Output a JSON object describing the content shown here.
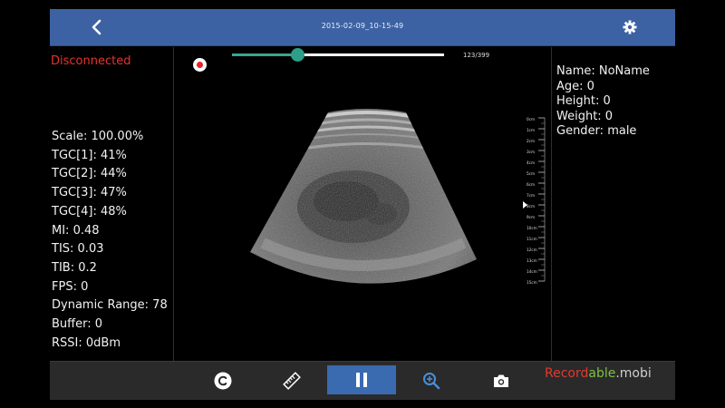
{
  "topbar": {
    "title": "2015-02-09_10-15-49",
    "back_icon": "chevron-left-icon",
    "settings_icon": "gear-icon"
  },
  "status": {
    "text": "Disconnected",
    "color": "#e8322f"
  },
  "params": [
    "Scale: 100.00%",
    "TGC[1]: 41%",
    "TGC[2]: 44%",
    "TGC[3]: 47%",
    "TGC[4]: 48%",
    "MI: 0.48",
    "TIS: 0.03",
    "TIB: 0.2",
    "FPS: 0",
    "Dynamic Range: 78",
    "Buffer: 0",
    "RSSI: 0dBm"
  ],
  "playback": {
    "frame_counter": "123/399",
    "current_frame": 123,
    "total_frames": 399,
    "accent_color": "#3aa58f"
  },
  "depth_scale": {
    "labels": [
      "0cm",
      "1cm",
      "2cm",
      "3cm",
      "4cm",
      "5cm",
      "6cm",
      "7cm",
      "8cm",
      "9cm",
      "10cm",
      "11cm",
      "12cm",
      "13cm",
      "14cm",
      "15cm"
    ],
    "marker_depth": 8
  },
  "patient": {
    "name": "Name: NoName",
    "age": "Age: 0",
    "height": "Height: 0",
    "weight": "Weight: 0",
    "gender": "Gender: male"
  },
  "bottombar": {
    "buttons": [
      {
        "icon": "c-circle-icon"
      },
      {
        "icon": "ruler-icon"
      },
      {
        "icon": "pause-icon"
      },
      {
        "icon": "zoom-in-icon"
      },
      {
        "icon": "camera-icon"
      }
    ],
    "watermark_prefix": "Record",
    "watermark_mid": "able",
    "watermark_suffix": ".mobi"
  }
}
